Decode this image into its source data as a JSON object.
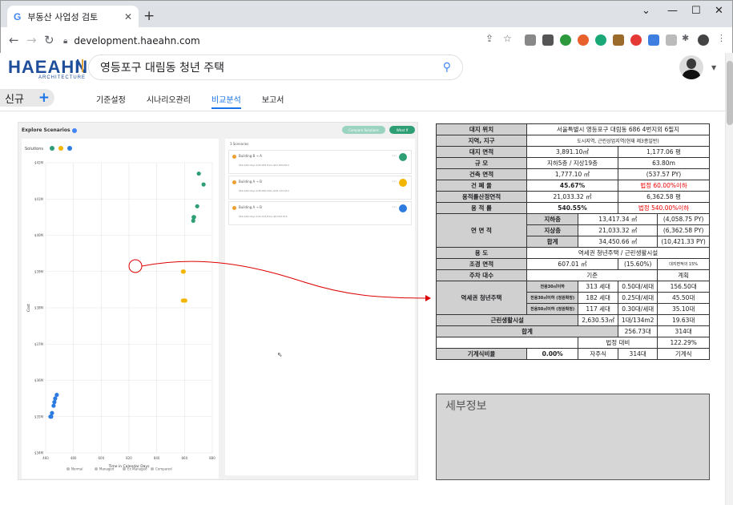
{
  "browser": {
    "tab_title": "부동산 사업성 검토",
    "tab_icon": "G",
    "url": "development.haeahn.com"
  },
  "logo": {
    "main": "HAEAHN",
    "sub": "ARCHITECTURE"
  },
  "search": {
    "value": "영등포구 대림동 청년 주택"
  },
  "new_button": {
    "label": "신규"
  },
  "tabs": [
    "기준설정",
    "시나리오관리",
    "비교분석",
    "보고서"
  ],
  "active_tab": "비교분석",
  "explore": {
    "title": "Explore Scenarios",
    "compare_btn": "Compare Solutions",
    "whatif_btn": "What If",
    "solutions_label": "Solutions",
    "scenarios_header": "3 Scenarios",
    "legend": [
      "Normal",
      "Managed",
      "Ex Managed",
      "Compared"
    ]
  },
  "scenarios": [
    {
      "title": "Building B → A",
      "sub": "$$$-$$$ Days    $40,483,814→$41,804,814",
      "color": "#2e9e74"
    },
    {
      "title": "Building A → B",
      "sub": "$$$-$$$ Days    $38,000,000→$39,123,014",
      "color": "#f2b500"
    },
    {
      "title": "Building A → B",
      "sub": "$$$-$$$ Days    $34,193,814→$5,094,014",
      "color": "#2d7be0"
    }
  ],
  "chart_data": {
    "type": "scatter",
    "xlabel": "Time in Calendar Days",
    "ylabel": "Cost",
    "x_ticks": [
      "460",
      "480",
      "600",
      "820",
      "840",
      "860",
      "880"
    ],
    "y_ticks": [
      "$42M",
      "$41M",
      "$40M",
      "$39M",
      "$38M",
      "$37M",
      "$36M",
      "$35M",
      "$34M"
    ],
    "xlim": [
      460,
      880
    ],
    "ylim": [
      34,
      42
    ],
    "series": [
      {
        "name": "Building B → A",
        "color": "#2e9e74",
        "points": [
          [
            846,
            41.7
          ],
          [
            858,
            41.4
          ],
          [
            842,
            40.8
          ],
          [
            834,
            40.5
          ],
          [
            833,
            40.5
          ],
          [
            832,
            40.4
          ]
        ]
      },
      {
        "name": "Building A → B",
        "color": "#f2b500",
        "points": [
          [
            808,
            39.0
          ],
          [
            806,
            39.0
          ],
          [
            812,
            38.2
          ],
          [
            808,
            38.2
          ],
          [
            806,
            38.2
          ]
        ]
      },
      {
        "name": "Building A → B",
        "color": "#2d7be0",
        "points": [
          [
            488,
            35.6
          ],
          [
            484,
            35.5
          ],
          [
            482,
            35.4
          ],
          [
            480,
            35.3
          ],
          [
            476,
            35.1
          ],
          [
            474,
            35.0
          ],
          [
            472,
            35.0
          ]
        ]
      }
    ]
  },
  "table": {
    "rows": [
      [
        "대지 위치",
        "서울특별시 영등포구 대림동 686 4번지외 6필지"
      ],
      [
        "지역, 지구",
        "도시지역, 근린상업지역(현재 제3종일반)"
      ],
      [
        "대지 면적",
        "3,891.10㎡",
        "1,177.06 평"
      ],
      [
        "규 모",
        "지하5층 / 지상19층",
        "63.80m"
      ],
      [
        "건축 면적",
        "1,777.10 ㎡",
        "(537.57 PY)"
      ],
      [
        "건 폐 율",
        "45.67%",
        "법정 60.00%이하"
      ],
      [
        "용적률산정연적",
        "21,033.32 ㎡",
        "6,362.58 평"
      ],
      [
        "용 적 률",
        "540.55%",
        "법정 540.00%이하"
      ],
      [
        "연 면 적",
        "지하층",
        "13,417.34 ㎡",
        "(4,058.75 PY)"
      ],
      [
        "",
        "지상층",
        "21,033.32 ㎡",
        "(6,362.58 PY)"
      ],
      [
        "",
        "합계",
        "34,450.66 ㎡",
        "(10,421.33 PY)"
      ],
      [
        "용 도",
        "역세권 청년주택 / 근린생활시설"
      ],
      [
        "조경 면적",
        "607.01 ㎡",
        "(15.60%)",
        "대지면적의 15%"
      ],
      [
        "주차 대수",
        "기준",
        "계획"
      ],
      [
        "역세권 청년주택",
        "전용30㎡이하",
        "313 세대",
        "0.50대/세대",
        "156.50대",
        "285대"
      ],
      [
        "",
        "전용30㎡이하 (정원확정)",
        "182 세대",
        "0.25대/세대",
        "45.50대",
        ""
      ],
      [
        "",
        "전용50㎡이하 (정원확정)",
        "117 세대",
        "0.30대/세대",
        "35.10대",
        ""
      ],
      [
        "근린생활시설",
        "2,630.53㎡",
        "1대/134m2",
        "19.63대",
        "29대"
      ],
      [
        "합계",
        "256.73대",
        "314대"
      ],
      [
        "",
        "법정 대비",
        "122.29%"
      ],
      [
        "기계식비율",
        "0.00%",
        "자주식",
        "314대",
        "기계식",
        "대"
      ]
    ]
  },
  "detail": {
    "label": "세부정보"
  },
  "colors": {
    "accent": "#1a73e8",
    "red": "#e00000"
  }
}
